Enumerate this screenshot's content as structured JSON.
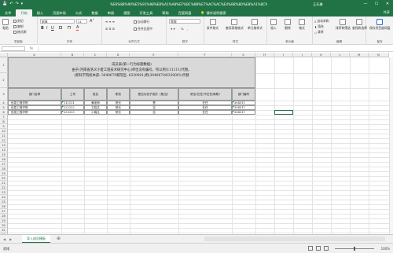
{
  "window": {
    "title": "%E6%88%90%E5%91%98%E8%A1%A8%EF%BC%88%E7%AC%AC%E4%B8%80%E8%A1%8C%E4%B8%BA.xlsx - Excel",
    "user": "王乐琳",
    "qat": [
      "💾",
      "↶",
      "↷",
      "▾"
    ],
    "controls": [
      "—",
      "☐",
      "✕"
    ]
  },
  "tabs": [
    "文件",
    "开始",
    "插入",
    "页面布局",
    "公式",
    "数据",
    "审阅",
    "视图",
    "开发工具",
    "帮助",
    "百度网盘"
  ],
  "active_tab": "开始",
  "tell_me": "操作说明搜索",
  "share": "共享",
  "ribbon": {
    "clipboard": {
      "label": "剪贴板",
      "paste": "粘贴",
      "cut": "剪切",
      "copy": "复制",
      "format_painter": "格式刷"
    },
    "font": {
      "label": "字体",
      "name": "宋体",
      "size": "11",
      "bold": "B",
      "italic": "I",
      "underline": "U"
    },
    "alignment": {
      "label": "对齐方式",
      "wrap": "自动换行",
      "merge": "合并后居中"
    },
    "number": {
      "label": "数字",
      "format": "常规",
      "percent": "%",
      "comma": ","
    },
    "styles": {
      "label": "样式",
      "cond": "条件格式",
      "table": "套用表格格式",
      "cell": "单元格样式"
    },
    "cells": {
      "label": "单元格",
      "insert": "插入",
      "delete": "删除",
      "format": "格式"
    },
    "editing": {
      "label": "编辑",
      "autosum": "自动求和",
      "fill": "填充",
      "clear": "清除",
      "sort": "排序和筛选",
      "find": "查找和选择"
    },
    "save": {
      "label": "保存",
      "save_to": "保存到百度网盘"
    }
  },
  "formula_bar": {
    "name_box": "",
    "fx": "fx",
    "value": ""
  },
  "columns": [
    "A",
    "B",
    "C",
    "D",
    "E",
    "F",
    "G",
    "H",
    "I",
    "J",
    "K",
    "L",
    "M",
    "N"
  ],
  "rows": [
    "1",
    "2",
    "3",
    "4",
    "5",
    "6",
    "7",
    "8",
    "9",
    "10",
    "11",
    "12",
    "13",
    "14",
    "15",
    "16",
    "17",
    "18",
    "19",
    "20",
    "21",
    "22",
    "23",
    "24",
    "25",
    "26",
    "27",
    "28",
    "29",
    "30",
    "31",
    "32",
    "33",
    "34"
  ],
  "sheet": {
    "title_lines": [
      "成员表(第一行为标题数据)",
      "由于(河南省洛义小麦工程技术研究中心)单位没有编号，所以用(111111)代替。",
      "(新科学院校本部: 3040670新院区: 6330001)用(3040670/6330001)代替"
    ],
    "headers": [
      "部门名称",
      "工号",
      "姓名",
      "职务",
      "是否为班子成员（是/否）",
      "职业(在任/不在任/离职)",
      "部门编号"
    ],
    "rows": [
      [
        "信息工程学院",
        "111111",
        "黄老师",
        "院长",
        "是",
        "在任",
        "304011"
      ],
      [
        "信息工程学院",
        "222222",
        "王晓文",
        "院长",
        "否",
        "在任",
        "304011"
      ],
      [
        "信息工程学院",
        "333333",
        "小晚主",
        "院长",
        "否",
        "在任",
        "304011"
      ]
    ]
  },
  "sheet_tabs": {
    "nav": [
      "◀",
      "▶"
    ],
    "active": "导入成员模板",
    "add": "⊕"
  },
  "status": {
    "ready": "就绪",
    "zoom": "100%"
  }
}
